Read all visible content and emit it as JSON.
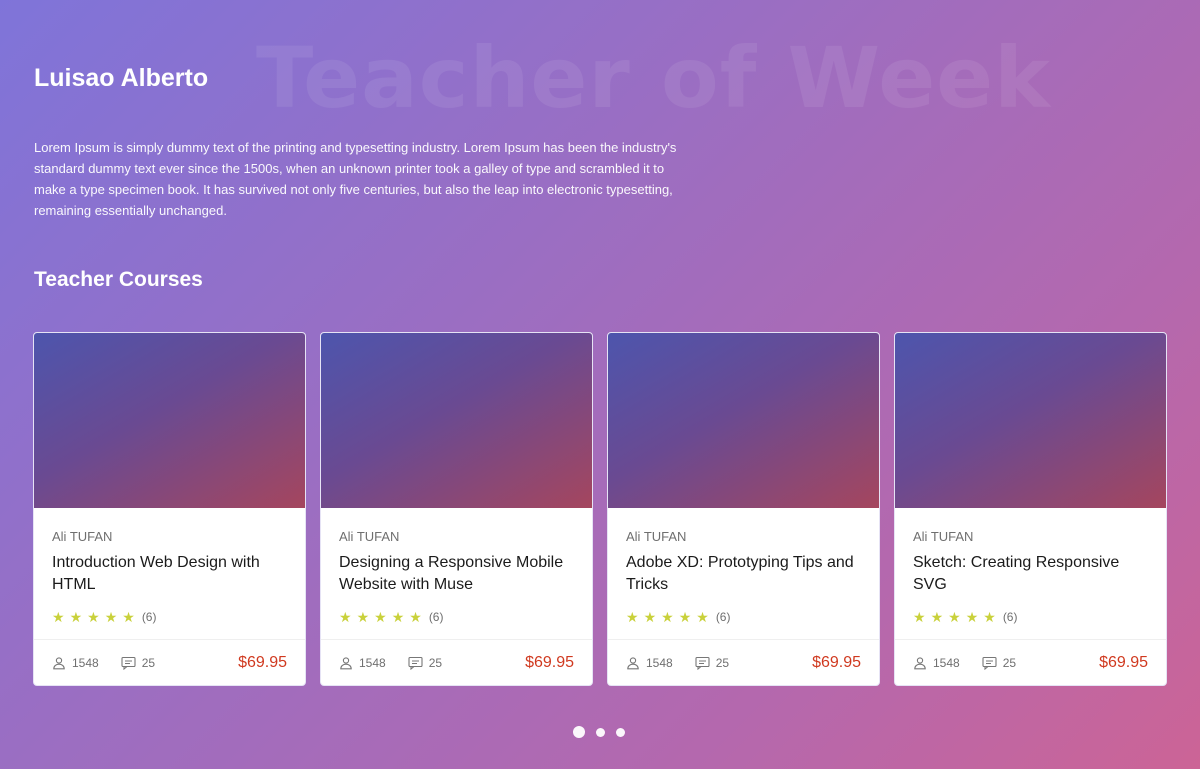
{
  "watermark": "Teacher of Week",
  "teacher": {
    "name": "Luisao Alberto",
    "bio": "Lorem Ipsum is simply dummy text of the printing and typesetting industry. Lorem Ipsum has been the industry's standard dummy text ever since the 1500s, when an unknown printer took a galley of type and scrambled it to make a type specimen book. It has survived not only five centuries, but also the leap into electronic typesetting, remaining essentially unchanged."
  },
  "courses_title": "Teacher Courses",
  "courses": [
    {
      "author": "Ali TUFAN",
      "title": "Introduction Web Design with HTML",
      "rating": 5,
      "reviews": "(6)",
      "students": "1548",
      "comments": "25",
      "price": "$69.95"
    },
    {
      "author": "Ali TUFAN",
      "title": "Designing a Responsive Mobile Website with Muse",
      "rating": 5,
      "reviews": "(6)",
      "students": "1548",
      "comments": "25",
      "price": "$69.95"
    },
    {
      "author": "Ali TUFAN",
      "title": "Adobe XD: Prototyping Tips and Tricks",
      "rating": 5,
      "reviews": "(6)",
      "students": "1548",
      "comments": "25",
      "price": "$69.95"
    },
    {
      "author": "Ali TUFAN",
      "title": "Sketch: Creating Responsive SVG",
      "rating": 5,
      "reviews": "(6)",
      "students": "1548",
      "comments": "25",
      "price": "$69.95"
    }
  ],
  "carousel": {
    "pages": 3,
    "active": 0
  },
  "colors": {
    "price": "#d0391f",
    "star": "#c9d13b"
  },
  "icons": {
    "students": "user-icon",
    "comments": "comment-icon",
    "rating": "star-icon"
  }
}
